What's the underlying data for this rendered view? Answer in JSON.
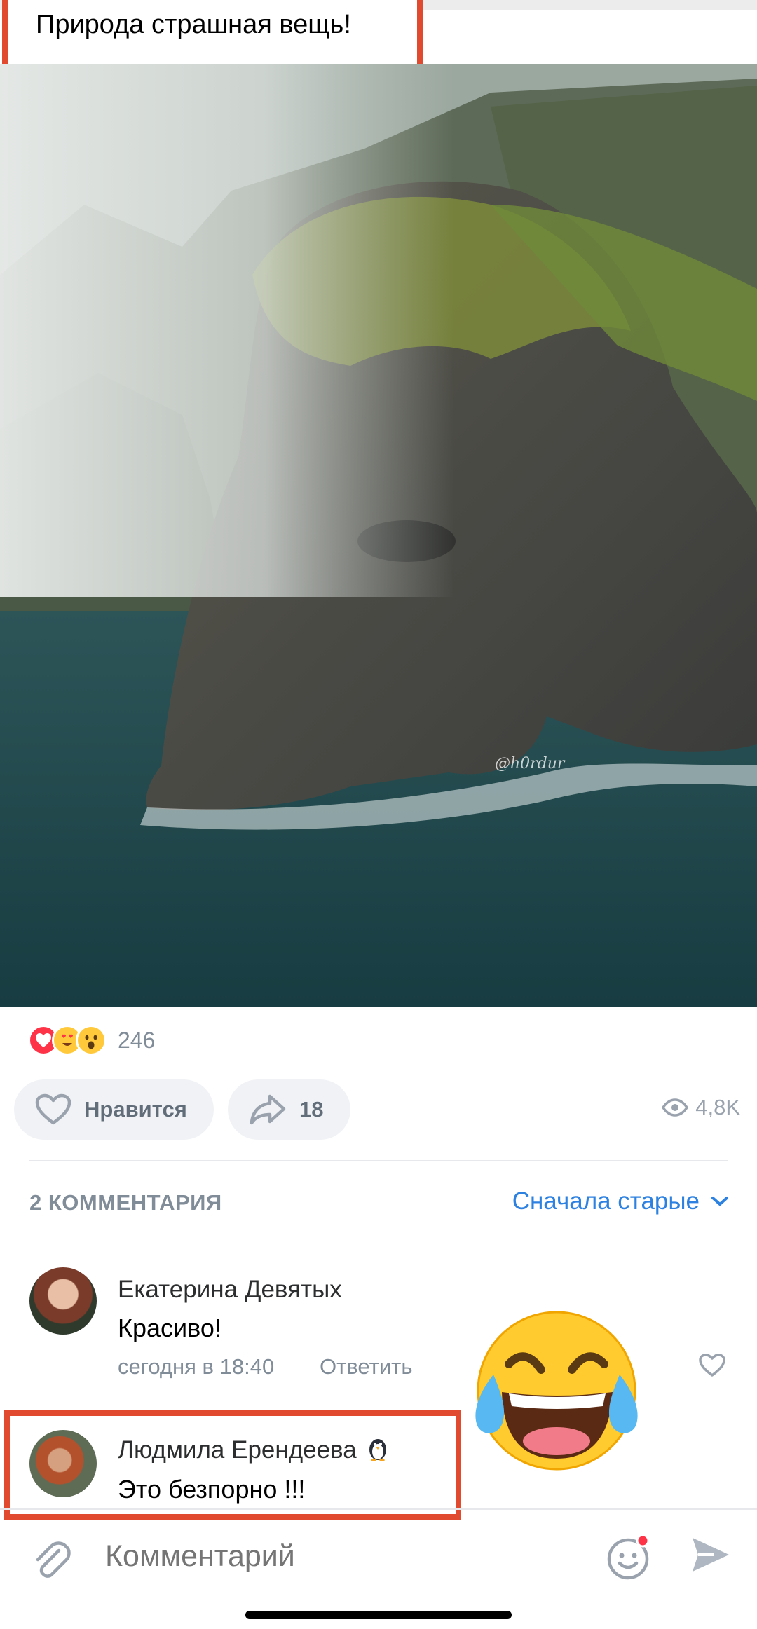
{
  "post": {
    "title": "Природа страшная вещь!",
    "image_watermark": "@h0rdur",
    "reactions": {
      "icons": [
        "heart-reaction",
        "heart-eyes-reaction",
        "wow-reaction"
      ],
      "count": "246"
    },
    "actions": {
      "like_label": "Нравится",
      "share_count": "18",
      "views": "4,8K"
    }
  },
  "comments": {
    "header": "2 КОММЕНТАРИЯ",
    "sort_label": "Сначала старые",
    "items": [
      {
        "author": "Екатерина Девятых",
        "text": "Красиво!",
        "time": "сегодня в 18:40",
        "reply_label": "Ответить"
      },
      {
        "author": "Людмила Ерендеева",
        "author_badge": "penguin-emoji",
        "text": "Это безпорно !!!"
      }
    ]
  },
  "composer": {
    "placeholder": "Комментарий"
  },
  "overlay": {
    "emoji": "rolling-on-floor-laughing-emoji"
  },
  "colors": {
    "accent": "#2d81e0",
    "highlight_border": "#e24a2f",
    "secondary_text": "#818c99",
    "pill_bg": "#f0f2f5"
  }
}
